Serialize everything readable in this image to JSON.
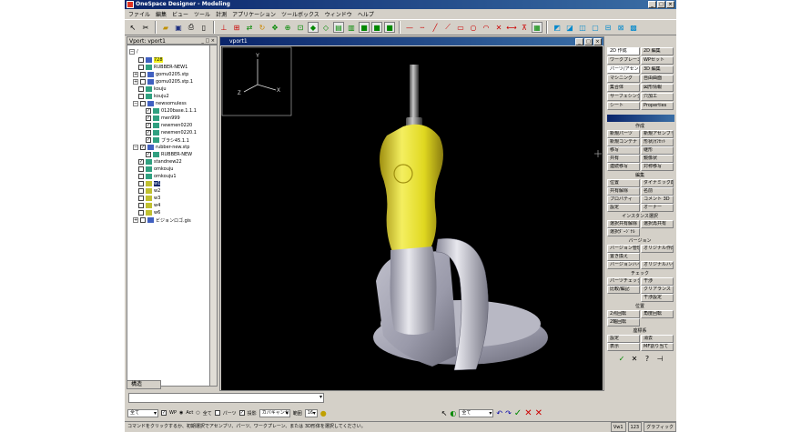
{
  "app": {
    "title": "OneSpace Designer - Modeling"
  },
  "menu": [
    "ファイル",
    "編集",
    "ビュー",
    "ツール",
    "計測",
    "アプリケーション",
    "ツールボックス",
    "ウィンドウ",
    "ヘルプ"
  ],
  "browser": {
    "header": "Vport: vport1",
    "tab": "構造",
    "items": [
      {
        "label": "/",
        "depth": 0
      },
      {
        "label": "728",
        "depth": 1
      },
      {
        "label": "RUBBER-NEW1",
        "depth": 1
      },
      {
        "label": "gomu0205.stp",
        "depth": 1
      },
      {
        "label": "gomu0205.stp.1",
        "depth": 1
      },
      {
        "label": "kouju",
        "depth": 1
      },
      {
        "label": "kouju2",
        "depth": 1
      },
      {
        "label": "newsomuless",
        "depth": 1
      },
      {
        "label": "0120base.1.1.1",
        "depth": 2
      },
      {
        "label": "men999",
        "depth": 2
      },
      {
        "label": "newmen0220",
        "depth": 2
      },
      {
        "label": "newmen0220.1",
        "depth": 2
      },
      {
        "label": "ブラシ45.1.1",
        "depth": 2
      },
      {
        "label": "rubber-new.stp",
        "depth": 1
      },
      {
        "label": "RUBBER-NEW",
        "depth": 2
      },
      {
        "label": "standnew22",
        "depth": 1
      },
      {
        "label": "omkouju",
        "depth": 1
      },
      {
        "label": "omkouju1",
        "depth": 1
      },
      {
        "label": "w1",
        "depth": 1
      },
      {
        "label": "w2",
        "depth": 1
      },
      {
        "label": "w3",
        "depth": 1
      },
      {
        "label": "w4",
        "depth": 1
      },
      {
        "label": "w6",
        "depth": 1
      },
      {
        "label": "ビジョンロゴ.gis",
        "depth": 1
      }
    ]
  },
  "viewport": {
    "title": "vport1",
    "axes": {
      "x": "X",
      "y": "Y",
      "z": "Z"
    }
  },
  "right_panel": {
    "tabs": [
      [
        "2D 作成",
        "2D 編集"
      ],
      [
        "ワークプレーン",
        "WPセット"
      ],
      [
        "パーツ/アセンブリ",
        "3D 編集"
      ],
      [
        "マシニング",
        "自由曲面"
      ],
      [
        "集合体",
        "図形情報"
      ],
      [
        "サーフェシング",
        "穴加工"
      ],
      [
        "シート",
        "Properties"
      ]
    ],
    "sections": [
      {
        "header": "作成",
        "buttons": [
          [
            "新規パーツ",
            "新規アセンブリ"
          ],
          [
            "新規コンテナ",
            "形状/ｵﾌｾｯﾄ"
          ],
          [
            "移写",
            "継形"
          ],
          [
            "共有",
            "鏡像状"
          ],
          [
            "連続移写",
            "対称移写"
          ]
        ]
      },
      {
        "header": "編集",
        "buttons": [
          [
            "位置",
            "ダイナミック配置"
          ],
          [
            "共有解除",
            "名前"
          ],
          [
            "プロパティ",
            "コメント 3D"
          ],
          [
            "設定",
            "オーナー"
          ]
        ]
      },
      {
        "header": "インスタンス選択",
        "buttons": [
          [
            "選択共有解除",
            "選択再共有"
          ],
          [
            "選択ﾀﾞｰｼﾞﾅﾙ",
            ""
          ]
        ]
      },
      {
        "header": "バージョン",
        "buttons": [
          [
            "バージョン管理",
            "オリジナル作成"
          ],
          [
            "置き換え",
            ""
          ],
          [
            "バージョンハイライト",
            "オリジナルハイライト"
          ]
        ]
      },
      {
        "header": "チェック",
        "buttons": [
          [
            "パーツチェック",
            "干渉"
          ],
          [
            "比較/編記",
            "クリアランス"
          ],
          [
            "",
            "干渉設定"
          ]
        ]
      },
      {
        "header": "位置",
        "buttons": [
          [
            "2点回転",
            "角度回転"
          ],
          [
            "2軸回転",
            ""
          ]
        ]
      },
      {
        "header": "座標系",
        "buttons": [
          [
            "設定",
            "消去"
          ],
          [
            "表示",
            "MF割り当て"
          ]
        ]
      }
    ]
  },
  "bottom": {
    "filter_all": "全て",
    "wp_label": "WP",
    "act_label": "Act",
    "all_label": "全て",
    "part_label": "パーツ",
    "proj_label": "投影",
    "cancel_label": "カバキャンセ",
    "range_label": "範囲",
    "range_value": "16",
    "pick_filter": "全て"
  },
  "status": {
    "message": "コマンドをクリックするか、初期選択でアセンブリ、パーツ、ワークプレーン、または 3D形体を選択してください。",
    "box1": "Vw1",
    "box2": "123",
    "box3": "グラフィック"
  },
  "colors": {
    "titlebar": "#0a246a",
    "handle_yellow": "#e8e020",
    "canvas": "#000000",
    "body_grey": "#a8a8b4"
  }
}
